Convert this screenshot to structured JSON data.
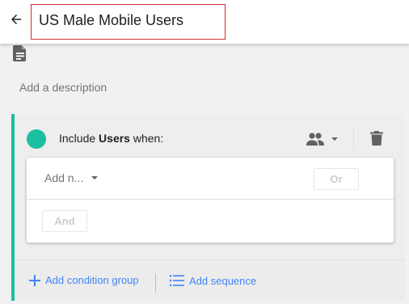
{
  "header": {
    "title": "US Male Mobile Users",
    "icons": {
      "back": "arrow-back-icon"
    }
  },
  "description": {
    "placeholder": "Add a description",
    "icon": "document-icon"
  },
  "segment": {
    "accent_color": "#1cbfa0",
    "include_prefix": "Include",
    "include_scope": "Users",
    "include_suffix": "when:",
    "scope_icon": "people-icon",
    "delete_icon": "trash-icon",
    "condition": {
      "add_placeholder": "Add n...",
      "or_label": "Or",
      "and_label": "And"
    },
    "footer": {
      "add_group_label": "Add condition group",
      "add_sequence_label": "Add sequence"
    }
  },
  "colors": {
    "link": "#4285f4",
    "title_border": "#d32f2f"
  }
}
